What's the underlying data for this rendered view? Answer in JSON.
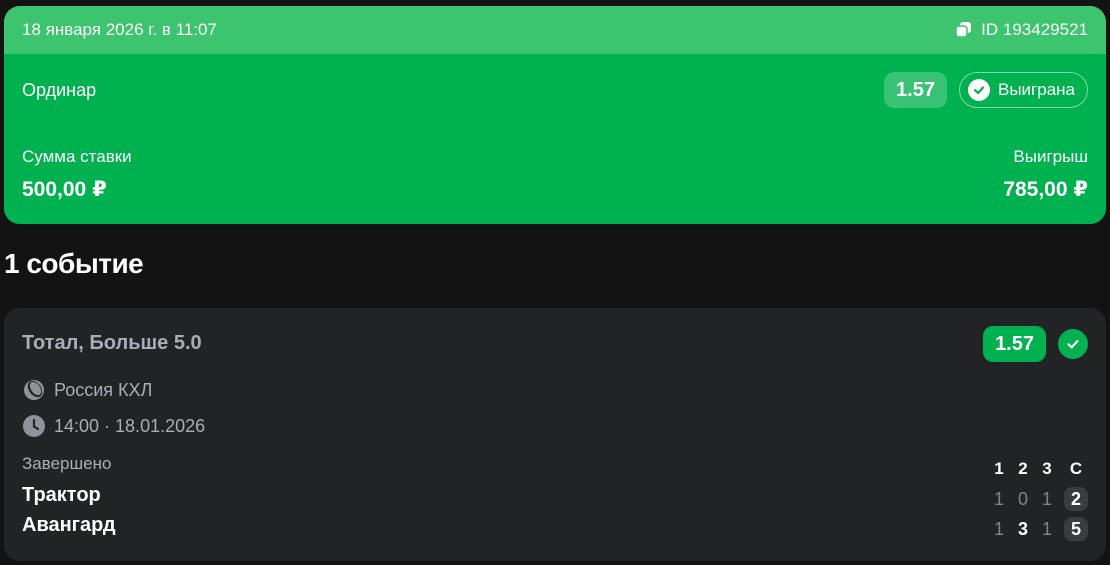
{
  "bet": {
    "datetime": "18 января 2026 г. в 11:07",
    "id_label": "ID 193429521",
    "type": "Ординар",
    "coefficient": "1.57",
    "status": "Выиграна",
    "stake_label": "Сумма ставки",
    "stake_value": "500,00 ₽",
    "win_label": "Выигрыш",
    "win_value": "785,00 ₽"
  },
  "events": {
    "title": "1 событие"
  },
  "event": {
    "market": "Тотал, Больше 5.0",
    "coefficient": "1.57",
    "league": "Россия КХЛ",
    "time": "14:00 · 18.01.2026",
    "status": "Завершено",
    "period_headers": [
      "1",
      "2",
      "3",
      "С"
    ],
    "teams": [
      {
        "name": "Трактор",
        "periods": [
          "1",
          "0",
          "1"
        ],
        "total": "2"
      },
      {
        "name": "Авангард",
        "periods": [
          "1",
          "3",
          "1"
        ],
        "total": "5"
      }
    ]
  },
  "colors": {
    "accent_green": "#00b14f",
    "header_green": "#3cc46e",
    "background": "#131314",
    "card": "#222325"
  }
}
